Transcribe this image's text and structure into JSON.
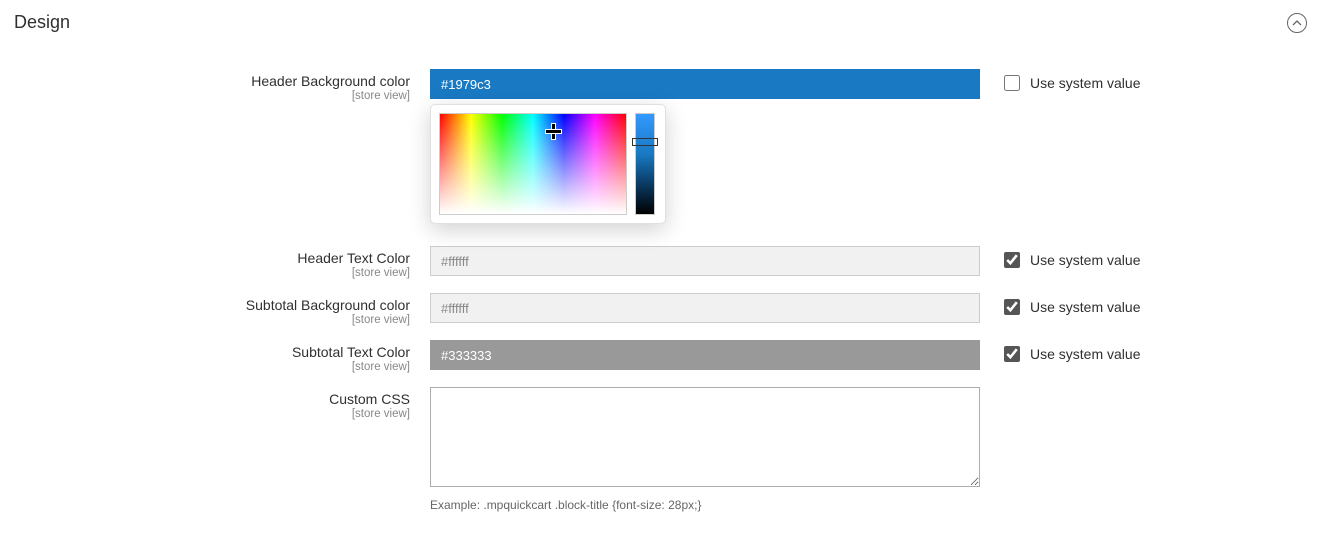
{
  "section": {
    "title": "Design"
  },
  "scope_label": "[store view]",
  "use_system_value": "Use system value",
  "fields": {
    "header_bg": {
      "label": "Header Background color",
      "value": "#1979c3",
      "use_system": false
    },
    "header_text": {
      "label": "Header Text Color",
      "value": "#ffffff",
      "use_system": true
    },
    "subtotal_bg": {
      "label": "Subtotal Background color",
      "value": "#ffffff",
      "use_system": true
    },
    "subtotal_text": {
      "label": "Subtotal Text Color",
      "value": "#333333",
      "use_system": true
    },
    "custom_css": {
      "label": "Custom CSS",
      "value": "",
      "helper": "Example: .mpquickcart .block-title {font-size: 28px;}"
    }
  }
}
